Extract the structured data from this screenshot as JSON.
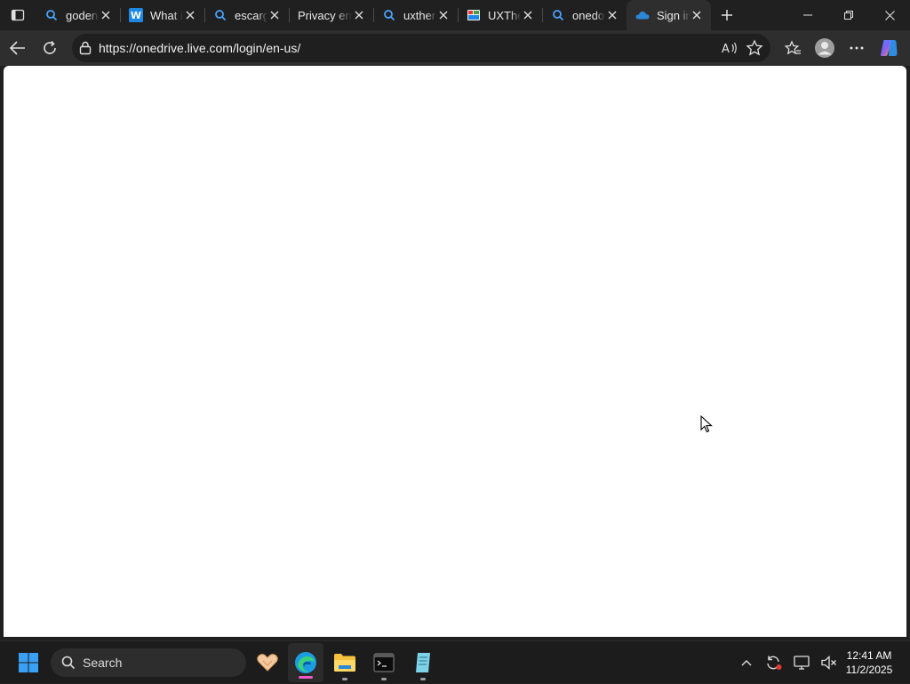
{
  "browser": {
    "tabs": [
      {
        "title": "goden",
        "icon": "search-icon",
        "active": false
      },
      {
        "title": "What i",
        "icon": "w-logo-icon",
        "active": false
      },
      {
        "title": "escarg",
        "icon": "search-icon",
        "active": false
      },
      {
        "title": "Privacy erro",
        "icon": "none",
        "active": false
      },
      {
        "title": "uxther",
        "icon": "search-icon",
        "active": false
      },
      {
        "title": "UXThe",
        "icon": "ux-favicon-icon",
        "active": false
      },
      {
        "title": "onedo",
        "icon": "search-icon",
        "active": false
      },
      {
        "title": "Sign in",
        "icon": "onedrive-cloud-icon",
        "active": true
      }
    ],
    "address": {
      "url": "https://onedrive.live.com/login/en-us/"
    }
  },
  "taskbar": {
    "search_label": "Search",
    "clock": {
      "time": "12:41 AM",
      "date": "11/2/2025"
    }
  },
  "colors": {
    "accent": "#0078d4",
    "onedrive_blue": "#0364b8",
    "edge_indicator": "#e85cc4"
  }
}
